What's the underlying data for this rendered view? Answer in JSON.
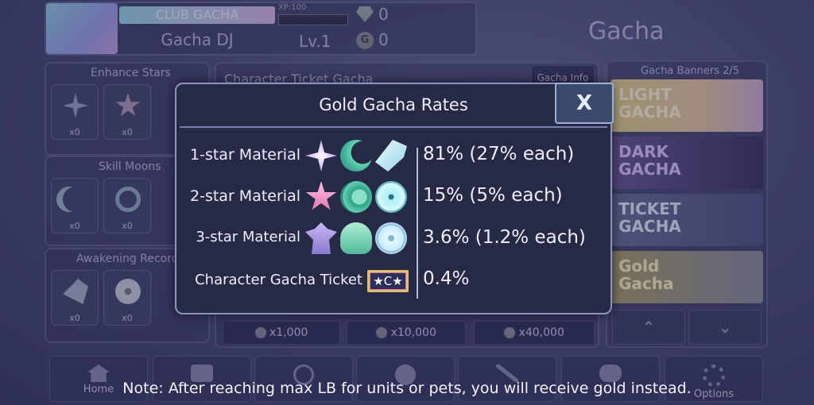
{
  "header": {
    "club": "CLUB GACHA",
    "player_name": "Gacha DJ",
    "xp": "XP:100",
    "level": "Lv.1",
    "gems": "0",
    "gold": "0",
    "screen_title": "Gacha"
  },
  "left": {
    "enhance_stars": "Enhance Stars",
    "skill_moons": "Skill Moons",
    "awakening_records": "Awakening Records",
    "count": "x0"
  },
  "center": {
    "ticket_title": "Character Ticket Gacha",
    "info_button": "Gacha Info",
    "prices": [
      "x1,000",
      "x10,000",
      "x40,000"
    ]
  },
  "banners": {
    "header": "Gacha Banners 2/5",
    "items": [
      "LIGHT GACHA",
      "DARK GACHA",
      "TICKET GACHA",
      "Gold Gacha"
    ]
  },
  "nav": {
    "home": "Home",
    "options": "Options"
  },
  "modal": {
    "title": "Gold Gacha Rates",
    "close": "X",
    "rows": [
      {
        "label": "1-star Material",
        "rate": "81% (27% each)"
      },
      {
        "label": "2-star Material",
        "rate": "15% (5% each)"
      },
      {
        "label": "3-star Material",
        "rate": "3.6% (1.2% each)"
      },
      {
        "label": "Character Gacha Ticket",
        "rate": "0.4%"
      }
    ]
  },
  "note": "Note: After reaching max LB for units or pets, you will receive gold instead."
}
